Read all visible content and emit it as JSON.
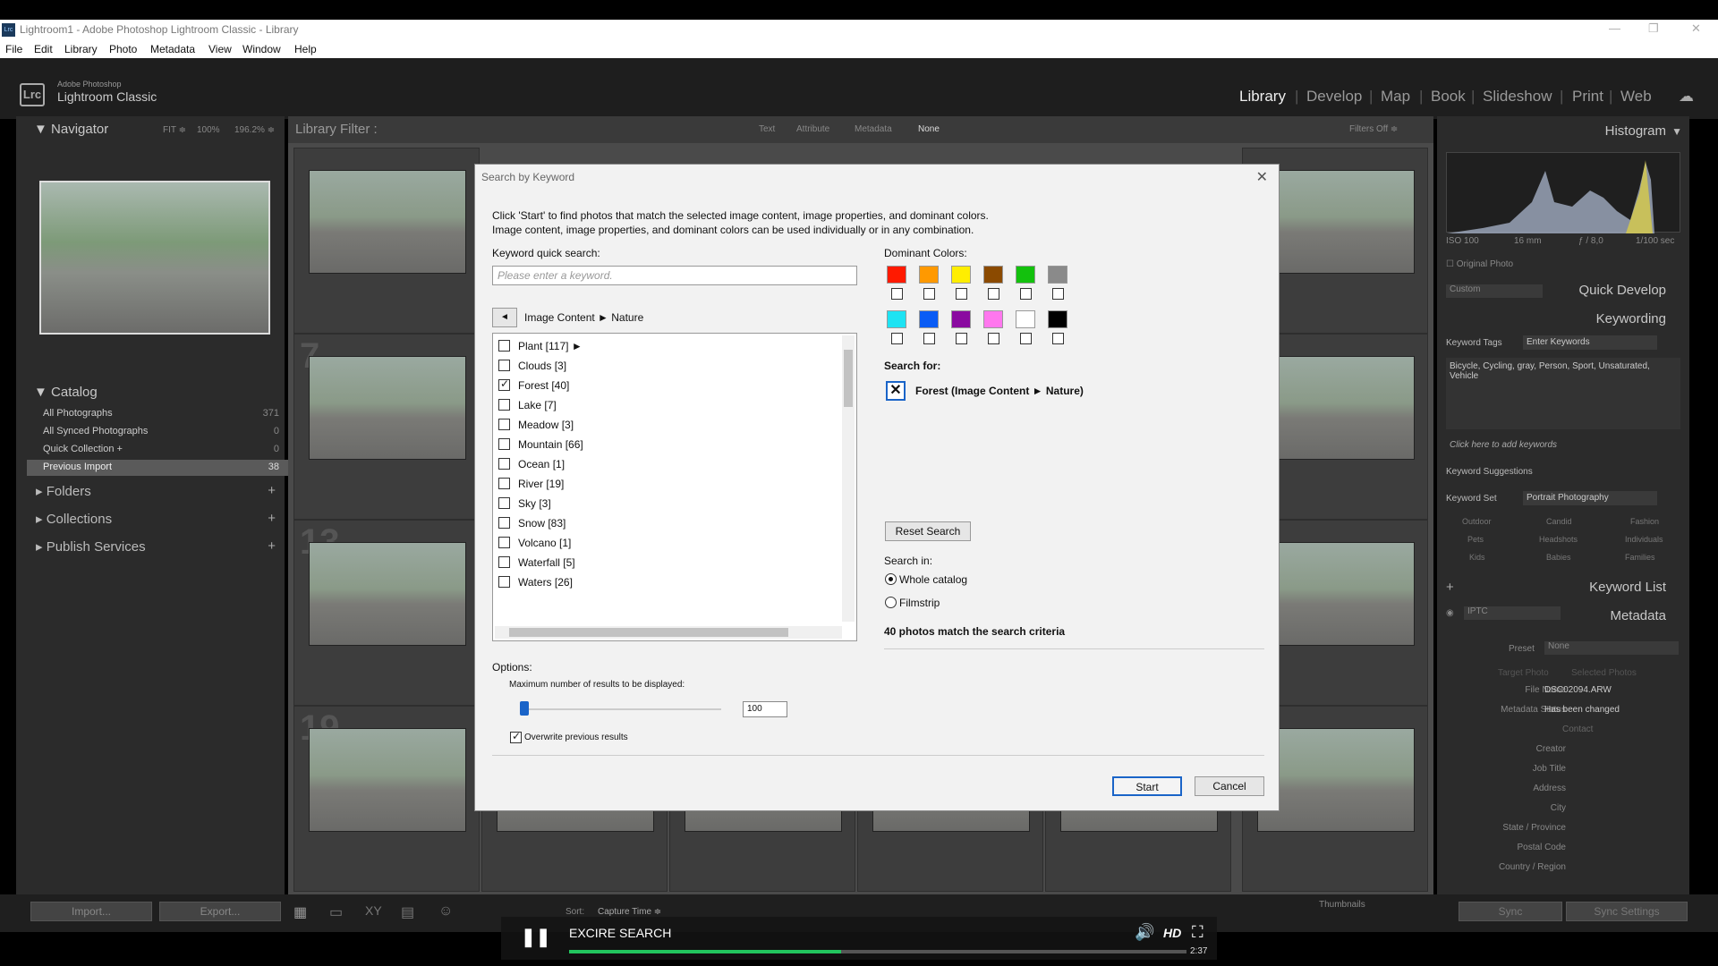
{
  "window": {
    "title": "Lightroom1 - Adobe Photoshop Lightroom Classic - Library",
    "icon": "Lrc"
  },
  "menu": [
    "File",
    "Edit",
    "Library",
    "Photo",
    "Metadata",
    "View",
    "Window",
    "Help"
  ],
  "brand": {
    "line1": "Adobe Photoshop",
    "line2": "Lightroom Classic",
    "logo": "Lrc"
  },
  "modules": [
    "Library",
    "Develop",
    "Map",
    "Book",
    "Slideshow",
    "Print",
    "Web"
  ],
  "navigator": {
    "title": "Navigator",
    "zoom": [
      "FIT ≑",
      "100%",
      "196.2% ≑"
    ]
  },
  "catalog": {
    "title": "Catalog",
    "items": [
      {
        "label": "All Photographs",
        "count": "371"
      },
      {
        "label": "All Synced Photographs",
        "count": "0"
      },
      {
        "label": "Quick Collection +",
        "count": "0"
      },
      {
        "label": "Previous Import",
        "count": "38"
      }
    ]
  },
  "sections": [
    "Folders",
    "Collections",
    "Publish Services"
  ],
  "library_filter": {
    "title": "Library Filter :",
    "tabs": [
      "Text",
      "Attribute",
      "Metadata",
      "None"
    ],
    "filters_off": "Filters Off ≑"
  },
  "right": {
    "histogram": "Histogram",
    "hist_info": [
      "ISO 100",
      "16 mm",
      "ƒ / 8,0",
      "1/100 sec"
    ],
    "original_photo": "Original Photo",
    "quick_develop": "Quick Develop",
    "custom": "Custom",
    "keywording": "Keywording",
    "keyword_tags": "Keyword Tags",
    "enter_keywords": "Enter Keywords",
    "keywords_text": "Bicycle, Cycling, gray, Person, Sport, Unsaturated, Vehicle",
    "click_add": "Click here to add keywords",
    "keyword_suggestions": "Keyword Suggestions",
    "keyword_set": "Keyword Set",
    "portrait": "Portrait Photography",
    "set_items": [
      "Outdoor",
      "Candid",
      "Fashion",
      "Pets",
      "Headshots",
      "Individuals",
      "Kids",
      "Babies",
      "Families"
    ],
    "keyword_list": "Keyword List",
    "metadata": "Metadata",
    "iptc": "IPTC",
    "preset": "Preset",
    "preset_val": "None",
    "target_photo": "Target Photo",
    "selected_photos": "Selected Photos",
    "fields": [
      {
        "label": "File Name",
        "value": "DSC02094.ARW"
      },
      {
        "label": "Metadata Status",
        "value": "Has been changed"
      },
      {
        "label": "",
        "value": "Contact"
      },
      {
        "label": "Creator",
        "value": ""
      },
      {
        "label": "Job Title",
        "value": ""
      },
      {
        "label": "Address",
        "value": ""
      },
      {
        "label": "City",
        "value": ""
      },
      {
        "label": "State / Province",
        "value": ""
      },
      {
        "label": "Postal Code",
        "value": ""
      },
      {
        "label": "Country / Region",
        "value": ""
      }
    ],
    "sync": "Sync",
    "sync_settings": "Sync Settings"
  },
  "dialog": {
    "title": "Search by Keyword",
    "intro1": "Click 'Start' to find photos that match the selected image content, image properties, and dominant colors.",
    "intro2": "Image content, image properties, and dominant colors can be used individually or in any combination.",
    "kqs_label": "Keyword quick search:",
    "kqs_placeholder": "Please enter a keyword.",
    "crumb": "Image Content ► Nature",
    "list": [
      {
        "label": "Plant [117] ►",
        "checked": false
      },
      {
        "label": "Clouds [3]",
        "checked": false
      },
      {
        "label": "Forest [40]",
        "checked": true
      },
      {
        "label": "Lake [7]",
        "checked": false
      },
      {
        "label": "Meadow [3]",
        "checked": false
      },
      {
        "label": "Mountain [66]",
        "checked": false
      },
      {
        "label": "Ocean [1]",
        "checked": false
      },
      {
        "label": "River [19]",
        "checked": false
      },
      {
        "label": "Sky [3]",
        "checked": false
      },
      {
        "label": "Snow [83]",
        "checked": false
      },
      {
        "label": "Volcano [1]",
        "checked": false
      },
      {
        "label": "Waterfall [5]",
        "checked": false
      },
      {
        "label": "Waters [26]",
        "checked": false
      }
    ],
    "dominant_label": "Dominant Colors:",
    "colors": [
      "#ff1a00",
      "#ff9900",
      "#ffee00",
      "#8b4a00",
      "#13c10d",
      "#8a8a8a",
      "#1ee3f3",
      "#0a5cf5",
      "#8a0aa0",
      "#ff77ee",
      "#ffffff",
      "#000000"
    ],
    "search_for_label": "Search for:",
    "search_for_item": "Forest (Image Content ► Nature)",
    "reset": "Reset Search",
    "search_in_label": "Search in:",
    "search_in": [
      "Whole catalog",
      "Filmstrip"
    ],
    "result": "40 photos match the search criteria",
    "options_label": "Options:",
    "max_label": "Maximum number of results to be displayed:",
    "max_value": "100",
    "overwrite": "Overwrite previous results",
    "start": "Start",
    "cancel": "Cancel"
  },
  "toolbar": {
    "import": "Import...",
    "export": "Export...",
    "sort": "Sort:",
    "sort_val": "Capture Time ≑",
    "thumbnails": "Thumbnails"
  },
  "video": {
    "title": "EXCIRE SEARCH",
    "time": "2:37",
    "hd": "HD",
    "progress": 0.44
  }
}
